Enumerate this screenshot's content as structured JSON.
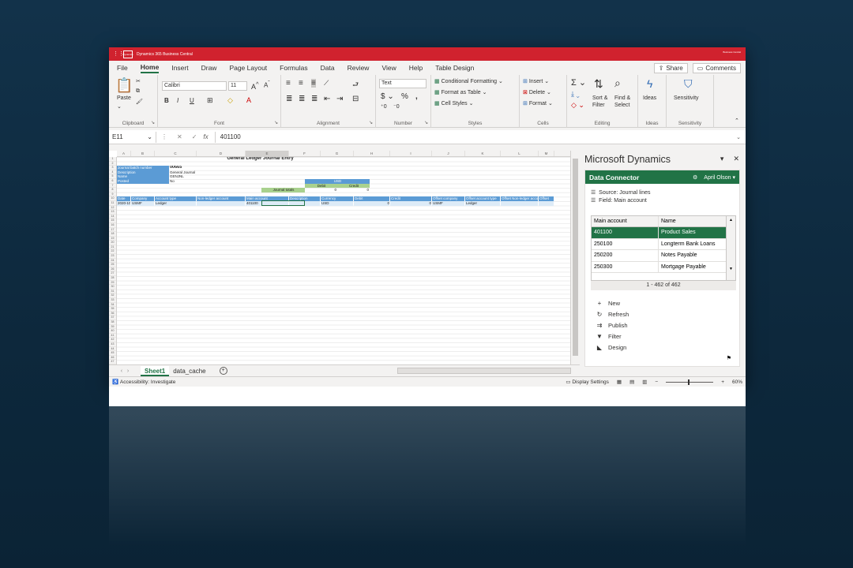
{
  "titlebar": {
    "app_name": "Dynamics 365 Business Central",
    "badge": "Dynamics",
    "user_short": "Business Central"
  },
  "menu": {
    "items": [
      "File",
      "Home",
      "Insert",
      "Draw",
      "Page Layout",
      "Formulas",
      "Data",
      "Review",
      "View",
      "Help",
      "Table Design"
    ],
    "active": "Home",
    "share_label": "Share",
    "comments_label": "Comments"
  },
  "ribbon": {
    "clipboard": {
      "label": "Clipboard",
      "paste": "Paste"
    },
    "font": {
      "label": "Font",
      "name": "Calibri",
      "size": "11",
      "bold": "B",
      "italic": "I",
      "underline": "U"
    },
    "alignment": {
      "label": "Alignment"
    },
    "number": {
      "label": "Number",
      "format": "Text"
    },
    "styles": {
      "label": "Styles",
      "conditional": "Conditional Formatting",
      "as_table": "Format as Table",
      "cell_styles": "Cell Styles"
    },
    "cells": {
      "label": "Cells",
      "insert": "Insert",
      "delete": "Delete",
      "format": "Format"
    },
    "editing": {
      "label": "Editing",
      "sort": "Sort &",
      "sort2": "Filter",
      "find": "Find &",
      "find2": "Select"
    },
    "ideas": {
      "label": "Ideas",
      "button": "Ideas"
    },
    "sensitivity": {
      "label": "Sensitivity",
      "button": "Sensitivity"
    }
  },
  "formula_bar": {
    "cell_ref": "E11",
    "fx": "fx",
    "value": "401100"
  },
  "sheet": {
    "columns": [
      "A",
      "B",
      "C",
      "D",
      "E",
      "F",
      "G",
      "H",
      "I",
      "J",
      "K",
      "L",
      "M"
    ],
    "title": "General Ledger Journal Entry",
    "batch_label": "Journal batch number",
    "batch_value": "00665",
    "desc_label": "Description",
    "desc_value": "General Journal",
    "name_label": "Name",
    "name_value": "GENJNL",
    "posted_label": "Posted",
    "posted_value": "No",
    "usd": "USD",
    "debit": "Debit",
    "credit": "Credit",
    "journal_totals": "Journal totals",
    "totals_debit": "0",
    "totals_credit": "0",
    "headers": [
      "Date",
      "Company",
      "Account type",
      "Non-ledger account",
      "Main account",
      "Description",
      "Currency",
      "Debit",
      "Credit",
      "Offset company",
      "Offset account type",
      "Offset Non-ledger account",
      "Offset"
    ],
    "row": [
      "2020-10-16",
      "USMF",
      "Ledger",
      "",
      "401100",
      "",
      "USD",
      "0",
      "0",
      "USMF",
      "Ledger",
      "",
      ""
    ]
  },
  "tabs": {
    "sheet1": "Sheet1",
    "data_cache": "data_cache"
  },
  "status": {
    "accessibility": "Accessibility: Investigate",
    "display_settings": "Display Settings",
    "zoom": "60%"
  },
  "pane": {
    "title": "Microsoft Dynamics",
    "connector": "Data Connector",
    "user": "April Olson",
    "source": "Source: Journal lines",
    "field": "Field: Main account",
    "col1": "Main account",
    "col2": "Name",
    "rows": [
      {
        "account": "401100",
        "name": "Product Sales"
      },
      {
        "account": "250100",
        "name": "Longterm Bank Loans"
      },
      {
        "account": "250200",
        "name": "Notes Payable"
      },
      {
        "account": "250300",
        "name": "Mortgage Payable"
      }
    ],
    "counter": "1 - 462 of 462",
    "actions": [
      "New",
      "Refresh",
      "Publish",
      "Filter",
      "Design"
    ]
  }
}
